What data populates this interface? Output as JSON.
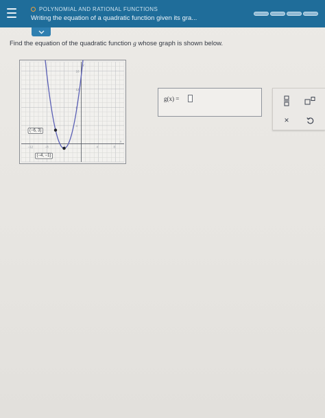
{
  "header": {
    "topic": "POLYNOMIAL AND RATIONAL FUNCTIONS",
    "title": "Writing the equation of a quadratic function given its gra..."
  },
  "prompt": {
    "before": "Find the equation of the quadratic function ",
    "var": "g",
    "after": " whose graph is shown below."
  },
  "graph": {
    "point_a_label": "(−6, 3)",
    "point_b_label": "(−4, −1)",
    "x_axis": "x",
    "y_axis": "y",
    "x_ticks": [
      "−12",
      "−8",
      "−4",
      "4",
      "8"
    ],
    "y_ticks": [
      "16",
      "12",
      "8",
      "4"
    ]
  },
  "chart_data": {
    "type": "line",
    "title": "",
    "xlabel": "x",
    "ylabel": "y",
    "xlim": [
      -14,
      10
    ],
    "ylim": [
      -4,
      18
    ],
    "grid": true,
    "curve": "parabola",
    "points": [
      {
        "x": -6,
        "y": 3,
        "label": "(−6, 3)"
      },
      {
        "x": -4,
        "y": -1,
        "label": "(−4, −1)"
      }
    ]
  },
  "answer": {
    "label": "g(x) ="
  },
  "tools": {
    "clear_label": "×"
  },
  "colors": {
    "header": "#1f6d9a",
    "curve": "#5a5fb5",
    "accent": "#f0a23c"
  }
}
